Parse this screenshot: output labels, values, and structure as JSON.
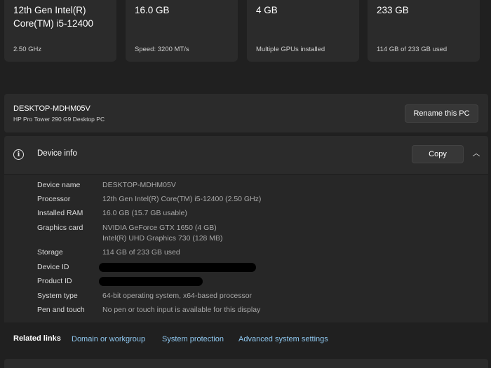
{
  "cards": [
    {
      "title": "12th Gen Intel(R) Core(TM) i5-12400",
      "sub": "2.50 GHz"
    },
    {
      "title": "16.0 GB",
      "sub": "Speed: 3200 MT/s"
    },
    {
      "title": "4 GB",
      "sub": "Multiple GPUs installed"
    },
    {
      "title": "233 GB",
      "sub": "114 GB of 233 GB used"
    }
  ],
  "pc": {
    "name": "DESKTOP-MDHM05V",
    "model": "HP Pro Tower 290 G9 Desktop PC",
    "rename_label": "Rename this PC"
  },
  "device_info": {
    "icon": "info-icon",
    "icon_glyph": "i",
    "title": "Device info",
    "copy_label": "Copy",
    "collapse_glyph": "︿",
    "rows": {
      "device_name": {
        "label": "Device name",
        "value": "DESKTOP-MDHM05V"
      },
      "processor": {
        "label": "Processor",
        "value": "12th Gen Intel(R) Core(TM) i5-12400 (2.50 GHz)"
      },
      "installed_ram": {
        "label": "Installed RAM",
        "value": "16.0 GB (15.7 GB usable)"
      },
      "graphics_card": {
        "label": "Graphics card",
        "value": "NVIDIA GeForce GTX 1650 (4 GB)",
        "value2": "Intel(R) UHD Graphics 730 (128 MB)"
      },
      "storage": {
        "label": "Storage",
        "value": "114 GB of 233 GB used"
      },
      "device_id": {
        "label": "Device ID"
      },
      "product_id": {
        "label": "Product ID"
      },
      "system_type": {
        "label": "System type",
        "value": "64-bit operating system, x64-based processor"
      },
      "pen_touch": {
        "label": "Pen and touch",
        "value": "No pen or touch input is available for this display"
      }
    }
  },
  "related": {
    "title": "Related links",
    "links": [
      "Domain or workgroup",
      "System protection",
      "Advanced system settings"
    ]
  },
  "colors": {
    "background": "#202020",
    "card": "#2b2b2b",
    "link": "#8fc8f0"
  }
}
